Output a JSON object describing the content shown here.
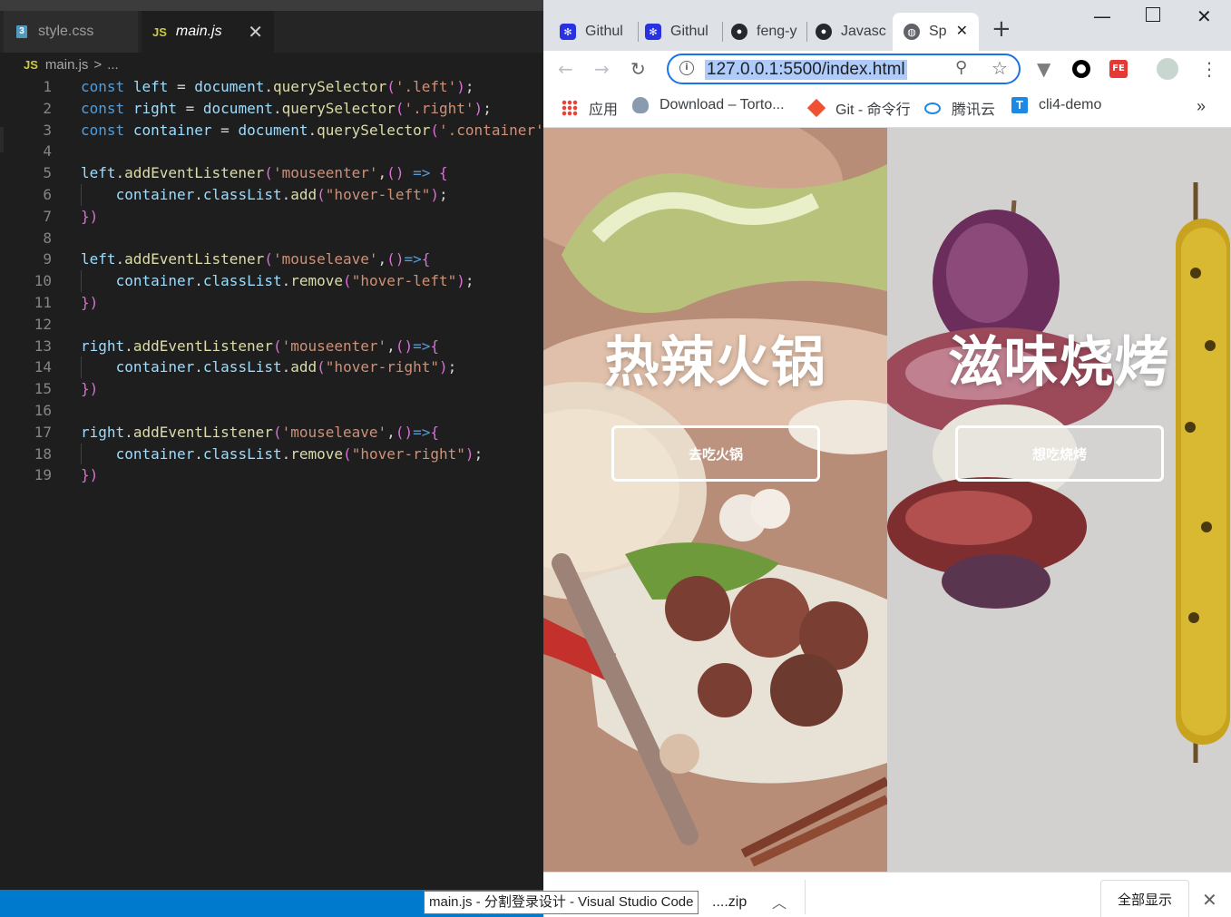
{
  "vscode": {
    "tabs": [
      {
        "label": "style.css",
        "icon": "css-file-icon"
      },
      {
        "label": "main.js",
        "icon": "js-file-icon",
        "active": true
      }
    ],
    "breadcrumb": {
      "file": "main.js",
      "separator": ">",
      "trail": "..."
    },
    "code_lines": [
      {
        "n": "1",
        "t": "const left = document.querySelector('.left');"
      },
      {
        "n": "2",
        "t": "const right = document.querySelector('.right');"
      },
      {
        "n": "3",
        "t": "const container = document.querySelector('.container'"
      },
      {
        "n": "4",
        "t": ""
      },
      {
        "n": "5",
        "t": "left.addEventListener('mouseenter',() => {"
      },
      {
        "n": "6",
        "t": "    container.classList.add(\"hover-left\");"
      },
      {
        "n": "7",
        "t": "})"
      },
      {
        "n": "8",
        "t": ""
      },
      {
        "n": "9",
        "t": "left.addEventListener('mouseleave',()=>{"
      },
      {
        "n": "10",
        "t": "    container.classList.remove(\"hover-left\");"
      },
      {
        "n": "11",
        "t": "})"
      },
      {
        "n": "12",
        "t": ""
      },
      {
        "n": "13",
        "t": "right.addEventListener('mouseenter',()=>{"
      },
      {
        "n": "14",
        "t": "    container.classList.add(\"hover-right\");"
      },
      {
        "n": "15",
        "t": "})"
      },
      {
        "n": "16",
        "t": ""
      },
      {
        "n": "17",
        "t": "right.addEventListener('mouseleave',()=>{"
      },
      {
        "n": "18",
        "t": "    container.classList.remove(\"hover-right\");"
      },
      {
        "n": "19",
        "t": "})"
      }
    ],
    "colors": {
      "keyword": "#569cd6",
      "variable": "#9cdcfe",
      "function": "#dcdcaa",
      "string": "#ce9178",
      "status_bar": "#007acc"
    }
  },
  "chrome": {
    "tabs": [
      {
        "label": "Githul",
        "icon": "baidu-paw-icon"
      },
      {
        "label": "Githul",
        "icon": "baidu-paw-icon"
      },
      {
        "label": "feng-y",
        "icon": "github-icon"
      },
      {
        "label": "Javasc",
        "icon": "github-icon"
      },
      {
        "label": "Sp",
        "icon": "globe-icon"
      }
    ],
    "url": "127.0.0.1:5500/index.html",
    "bookmarks": [
      {
        "label": "应用",
        "icon": "apps-grid-icon"
      },
      {
        "label": "Download – Torto...",
        "icon": "tortoise-icon"
      },
      {
        "label": "Git - 命令行",
        "icon": "git-icon"
      },
      {
        "label": "腾讯云",
        "icon": "tencent-cloud-icon"
      },
      {
        "label": "cli4-demo",
        "icon": "t-letter-icon"
      }
    ],
    "bookmarks_overflow": "»",
    "page": {
      "left": {
        "title": "热辣火锅",
        "button": "去吃火锅"
      },
      "right": {
        "title": "滋味烧烤",
        "button": "想吃烧烤"
      }
    },
    "download_bar": {
      "file": "....zip",
      "show_all": "全部显示"
    },
    "tooltip": "main.js - 分割登录设计 - Visual Studio Code"
  }
}
